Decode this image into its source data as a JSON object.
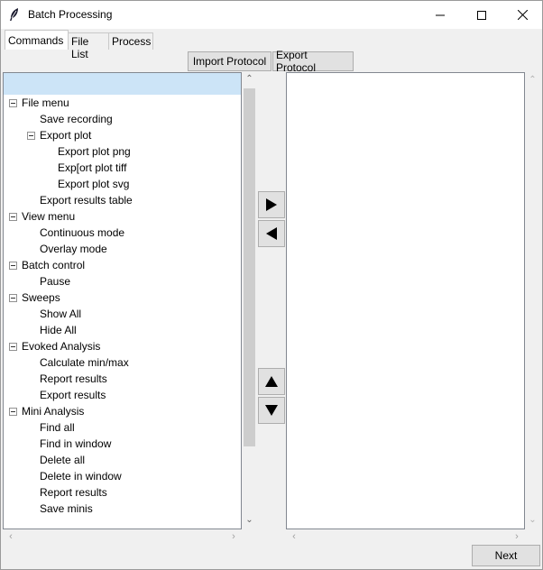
{
  "window": {
    "title": "Batch Processing",
    "icon": "feather-icon",
    "controls": [
      "minimize-icon",
      "maximize-icon",
      "close-icon"
    ]
  },
  "tabs": [
    {
      "label": "Commands",
      "active": true
    },
    {
      "label": "File List",
      "active": false
    },
    {
      "label": "Process",
      "active": false
    }
  ],
  "toolbar": {
    "import_label": "Import Protocol",
    "export_label": "Export Protocol"
  },
  "tree": {
    "selected_row": "",
    "items": [
      {
        "label": "File menu",
        "level": 0,
        "expanded": true
      },
      {
        "label": "Save recording",
        "level": 1
      },
      {
        "label": "Export plot",
        "level": 1,
        "expanded": true
      },
      {
        "label": "Export plot png",
        "level": 2
      },
      {
        "label": "Exp[ort plot tiff",
        "level": 2
      },
      {
        "label": "Export plot svg",
        "level": 2
      },
      {
        "label": "Export results table",
        "level": 1
      },
      {
        "label": "View menu",
        "level": 0,
        "expanded": true
      },
      {
        "label": "Continuous mode",
        "level": 1
      },
      {
        "label": "Overlay mode",
        "level": 1
      },
      {
        "label": "Batch control",
        "level": 0,
        "expanded": true
      },
      {
        "label": "Pause",
        "level": 1
      },
      {
        "label": "Sweeps",
        "level": 0,
        "expanded": true
      },
      {
        "label": "Show All",
        "level": 1
      },
      {
        "label": "Hide All",
        "level": 1
      },
      {
        "label": "Evoked Analysis",
        "level": 0,
        "expanded": true
      },
      {
        "label": "Calculate min/max",
        "level": 1
      },
      {
        "label": "Report results",
        "level": 1
      },
      {
        "label": "Export results",
        "level": 1
      },
      {
        "label": "Mini Analysis",
        "level": 0,
        "expanded": true
      },
      {
        "label": "Find all",
        "level": 1
      },
      {
        "label": "Find in window",
        "level": 1
      },
      {
        "label": "Delete all",
        "level": 1
      },
      {
        "label": "Delete in window",
        "level": 1
      },
      {
        "label": "Report results",
        "level": 1
      },
      {
        "label": "Save minis",
        "level": 1
      }
    ]
  },
  "transfer_buttons": {
    "add": "right-arrow-icon",
    "remove": "left-arrow-icon",
    "move_up": "up-arrow-icon",
    "move_down": "down-arrow-icon"
  },
  "protocol_list": {
    "items": []
  },
  "footer": {
    "next_label": "Next"
  }
}
